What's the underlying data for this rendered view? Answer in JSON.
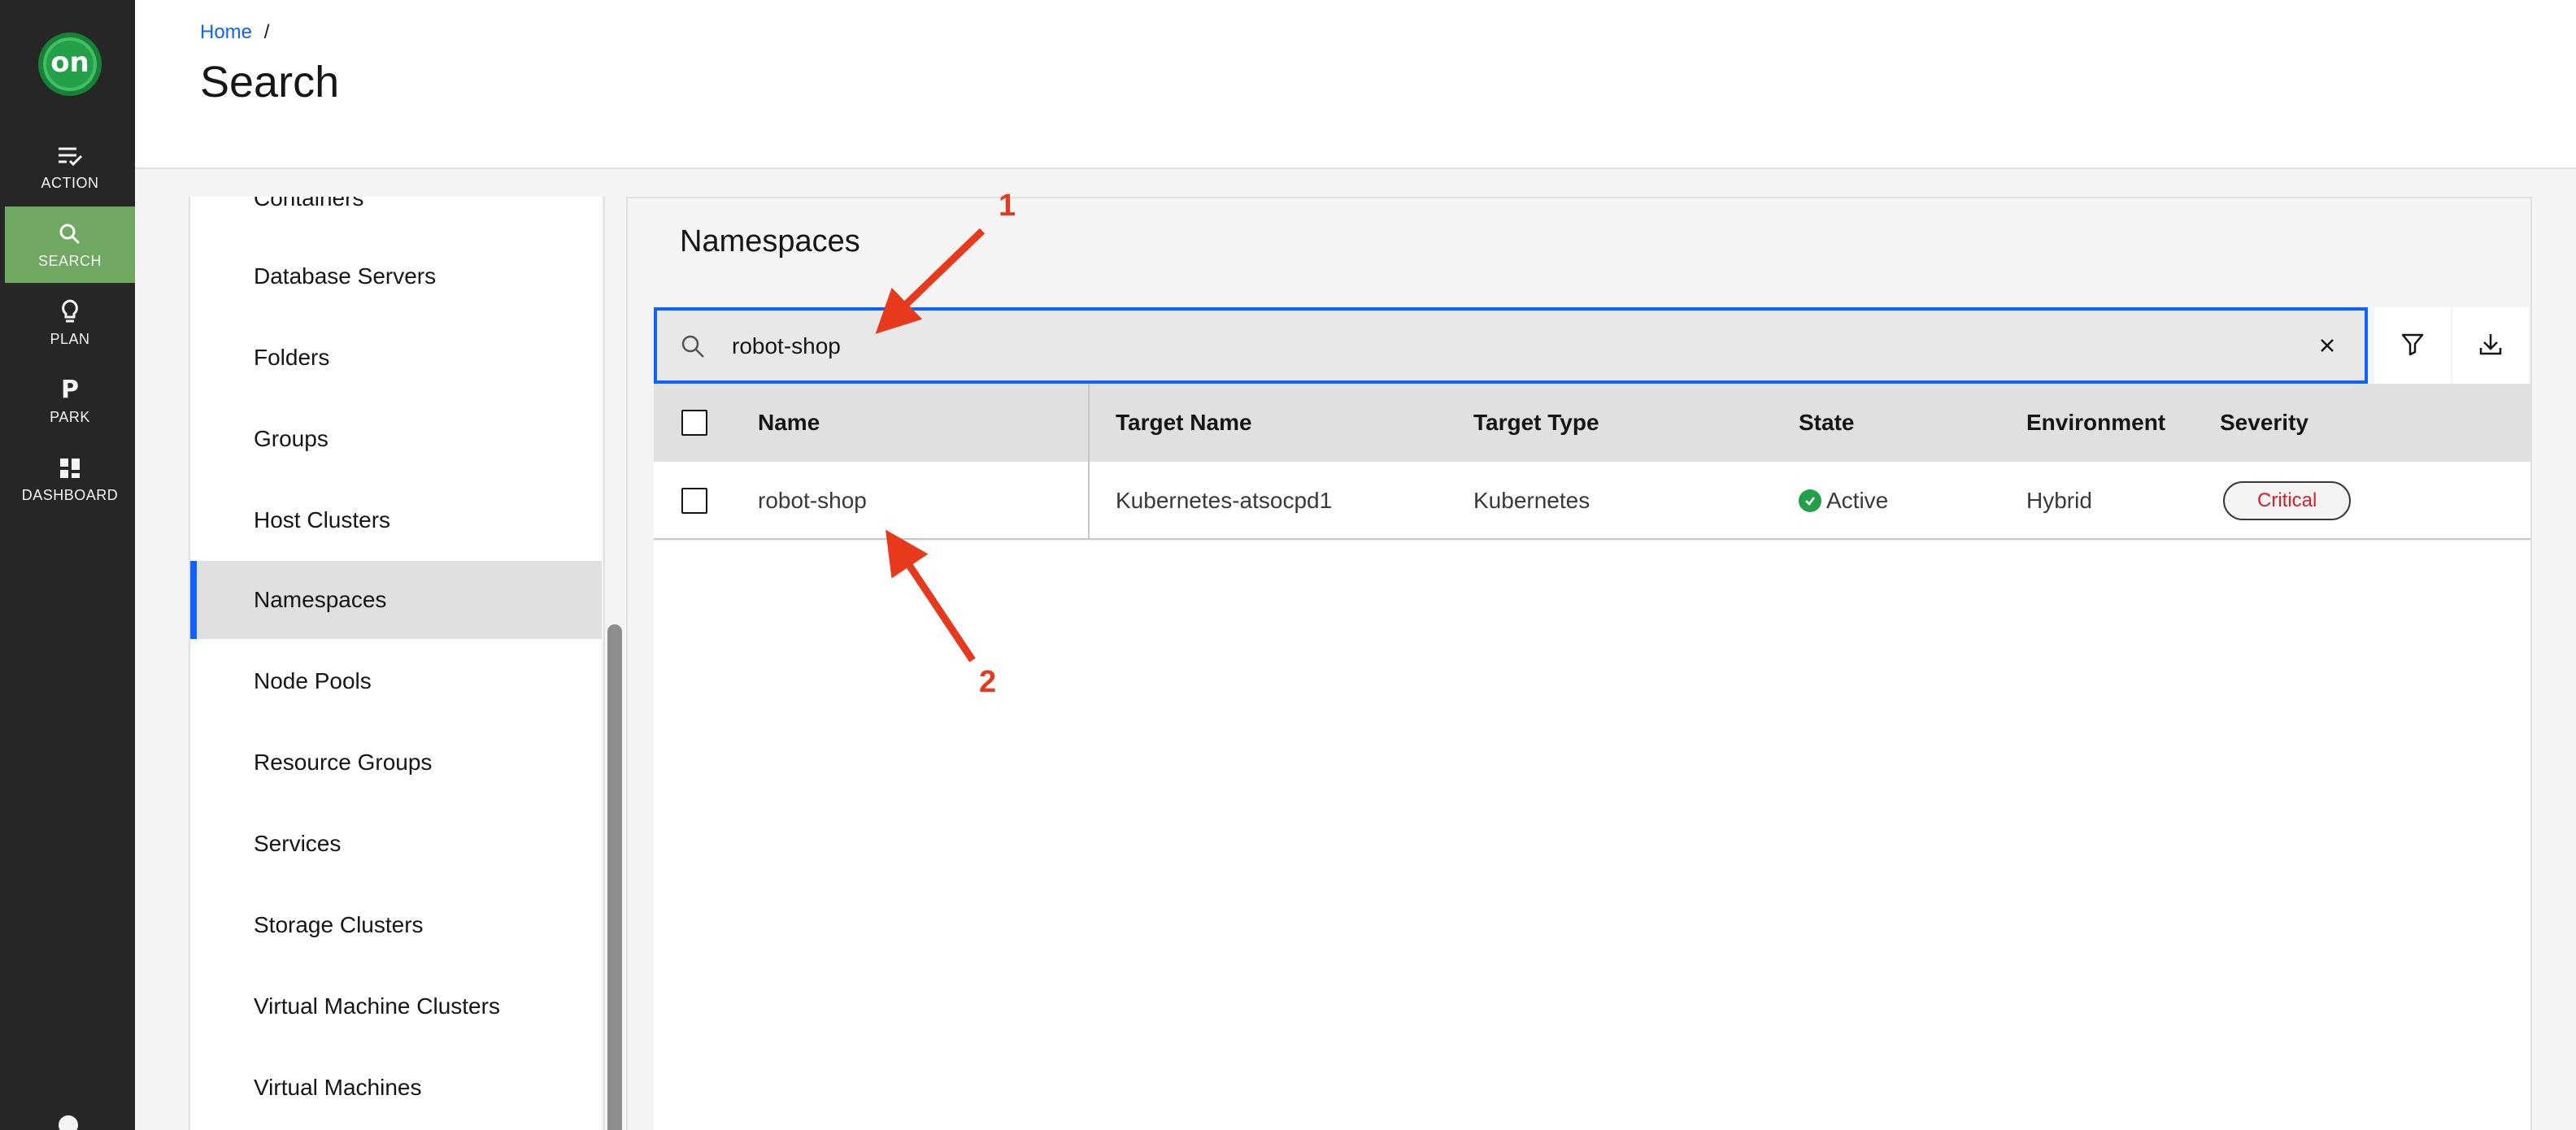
{
  "nav": {
    "logo_text": "on",
    "items": [
      {
        "label": "ACTION",
        "icon": "action-checklist-icon"
      },
      {
        "label": "SEARCH",
        "icon": "search-icon"
      },
      {
        "label": "PLAN",
        "icon": "lightbulb-icon"
      },
      {
        "label": "PARK",
        "icon": "park-icon",
        "glyph": "P"
      },
      {
        "label": "DASHBOARD",
        "icon": "dashboard-icon"
      }
    ],
    "active": "SEARCH",
    "colors": {
      "rail": "#262626",
      "active": "#6fa860",
      "logo": "#24a148"
    }
  },
  "header": {
    "breadcrumb": {
      "home": "Home",
      "separator": "/"
    },
    "title": "Search"
  },
  "categories": {
    "items": [
      "Containers",
      "Database Servers",
      "Folders",
      "Groups",
      "Host Clusters",
      "Namespaces",
      "Node Pools",
      "Resource Groups",
      "Services",
      "Storage Clusters",
      "Virtual Machine Clusters",
      "Virtual Machines"
    ],
    "selected": "Namespaces"
  },
  "main": {
    "title": "Namespaces",
    "search": {
      "value": "robot-shop",
      "placeholder": ""
    },
    "table": {
      "columns": [
        "Name",
        "Target Name",
        "Target Type",
        "State",
        "Environment",
        "Severity"
      ],
      "rows": [
        {
          "name": "robot-shop",
          "target_name": "Kubernetes-atsocpd1",
          "target_type": "Kubernetes",
          "state": "Active",
          "environment": "Hybrid",
          "severity": "Critical"
        }
      ]
    }
  },
  "annotations": [
    {
      "label": "1"
    },
    {
      "label": "2"
    }
  ],
  "colors": {
    "accent": "#0f62fe",
    "annotation": "#e8391d",
    "critical": "#da1e28",
    "active_state": "#24a148"
  }
}
